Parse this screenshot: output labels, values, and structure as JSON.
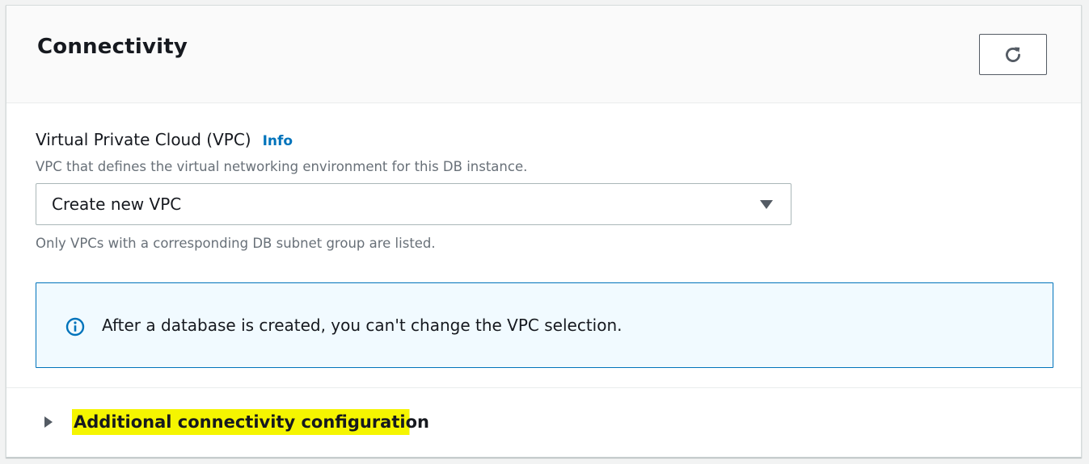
{
  "panel": {
    "title": "Connectivity",
    "refresh_icon": "refresh-icon"
  },
  "vpc": {
    "label": "Virtual Private Cloud (VPC)",
    "info_link": "Info",
    "description": "VPC that defines the virtual networking environment for this DB instance.",
    "selected_value": "Create new VPC",
    "caret_icon": "caret-down-icon",
    "constraint": "Only VPCs with a corresponding DB subnet group are listed."
  },
  "alert": {
    "icon": "info-circle-icon",
    "text": "After a database is created, you can't change the VPC selection.",
    "accent_color": "#0073bb"
  },
  "additional": {
    "caret_icon": "caret-right-icon",
    "label": "Additional connectivity configuration",
    "highlight_color": "#f5f500"
  }
}
